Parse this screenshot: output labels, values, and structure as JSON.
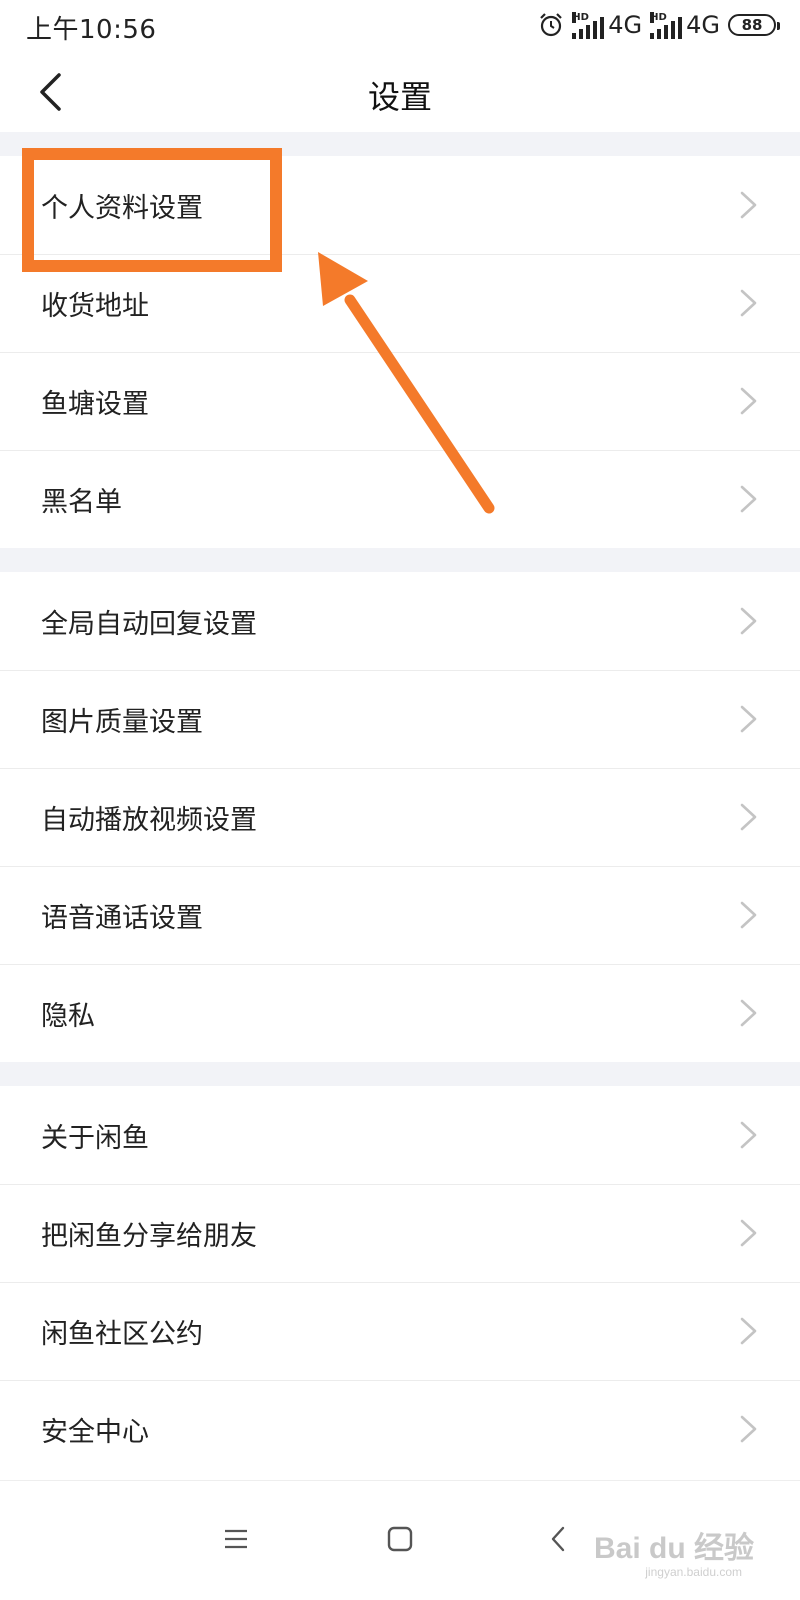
{
  "status_bar": {
    "time": "上午10:56",
    "network_1": "4G",
    "network_2": "4G",
    "battery": "88",
    "hd": "HD"
  },
  "header": {
    "title": "设置"
  },
  "sections": [
    {
      "items": [
        {
          "label": "个人资料设置"
        },
        {
          "label": "收货地址"
        },
        {
          "label": "鱼塘设置"
        },
        {
          "label": "黑名单"
        }
      ]
    },
    {
      "items": [
        {
          "label": "全局自动回复设置"
        },
        {
          "label": "图片质量设置"
        },
        {
          "label": "自动播放视频设置"
        },
        {
          "label": "语音通话设置"
        },
        {
          "label": "隐私"
        }
      ]
    },
    {
      "items": [
        {
          "label": "关于闲鱼"
        },
        {
          "label": "把闲鱼分享给朋友"
        },
        {
          "label": "闲鱼社区公约"
        },
        {
          "label": "安全中心"
        }
      ]
    }
  ],
  "watermark": {
    "text": "Bai du 经验",
    "sub": "jingyan.baidu.com"
  },
  "colors": {
    "annotation": "#f47a2a",
    "section_gap": "#f2f3f7"
  }
}
